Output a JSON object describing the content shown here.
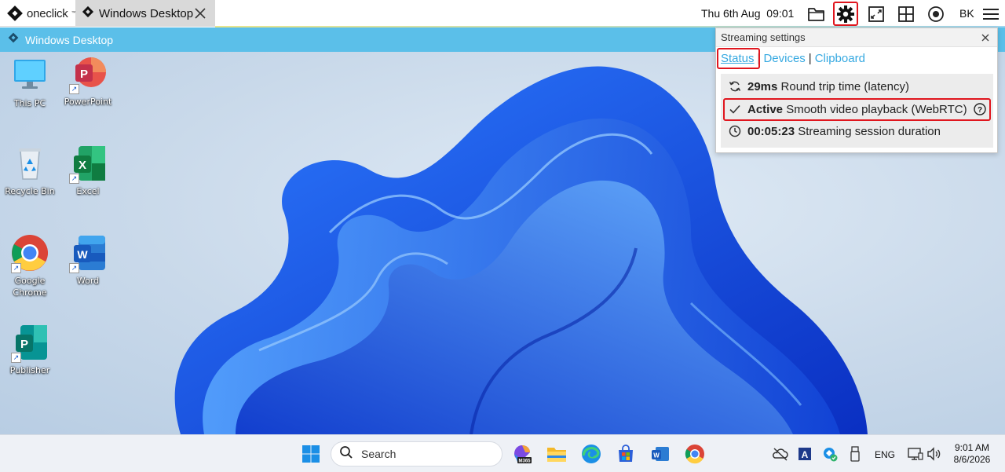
{
  "app": {
    "brand": "oneclick",
    "brand_tm": "™"
  },
  "tab": {
    "title": "Windows Desktop"
  },
  "topbar": {
    "datetime": "Thu 6th Aug  09:01",
    "user_initials": "BK",
    "icons": [
      "folder-icon",
      "gear-icon",
      "resize-icon",
      "grid-icon",
      "record-icon",
      "menu-icon"
    ]
  },
  "window_strip": {
    "title": "Windows Desktop"
  },
  "desktop": {
    "icons": [
      {
        "label": "This PC"
      },
      {
        "label": "PowerPoint"
      },
      {
        "label": "Recycle Bin"
      },
      {
        "label": "Excel"
      },
      {
        "label": "Google Chrome"
      },
      {
        "label": "Word"
      },
      {
        "label": "Publisher"
      }
    ]
  },
  "popup": {
    "title": "Streaming settings",
    "tabs": [
      "Status",
      "Devices",
      "Clipboard"
    ],
    "active_tab": "Status",
    "rows": [
      {
        "value": "29ms",
        "text": "Round trip time (latency)",
        "icon": "sync-icon"
      },
      {
        "value": "Active",
        "text": "Smooth video playback (WebRTC)",
        "icon": "check-icon"
      },
      {
        "value": "00:05:23",
        "text": "Streaming session duration",
        "icon": "clock-icon"
      }
    ]
  },
  "taskbar": {
    "search_placeholder": "Search",
    "m365_label": "M365",
    "tray_lang": "ENG",
    "tray_time": "9:01 AM",
    "tray_date": "8/6/2026"
  },
  "colors": {
    "accent": "#36a9e1",
    "highlight": "#e0161e",
    "strip": "#5bbfe9"
  }
}
